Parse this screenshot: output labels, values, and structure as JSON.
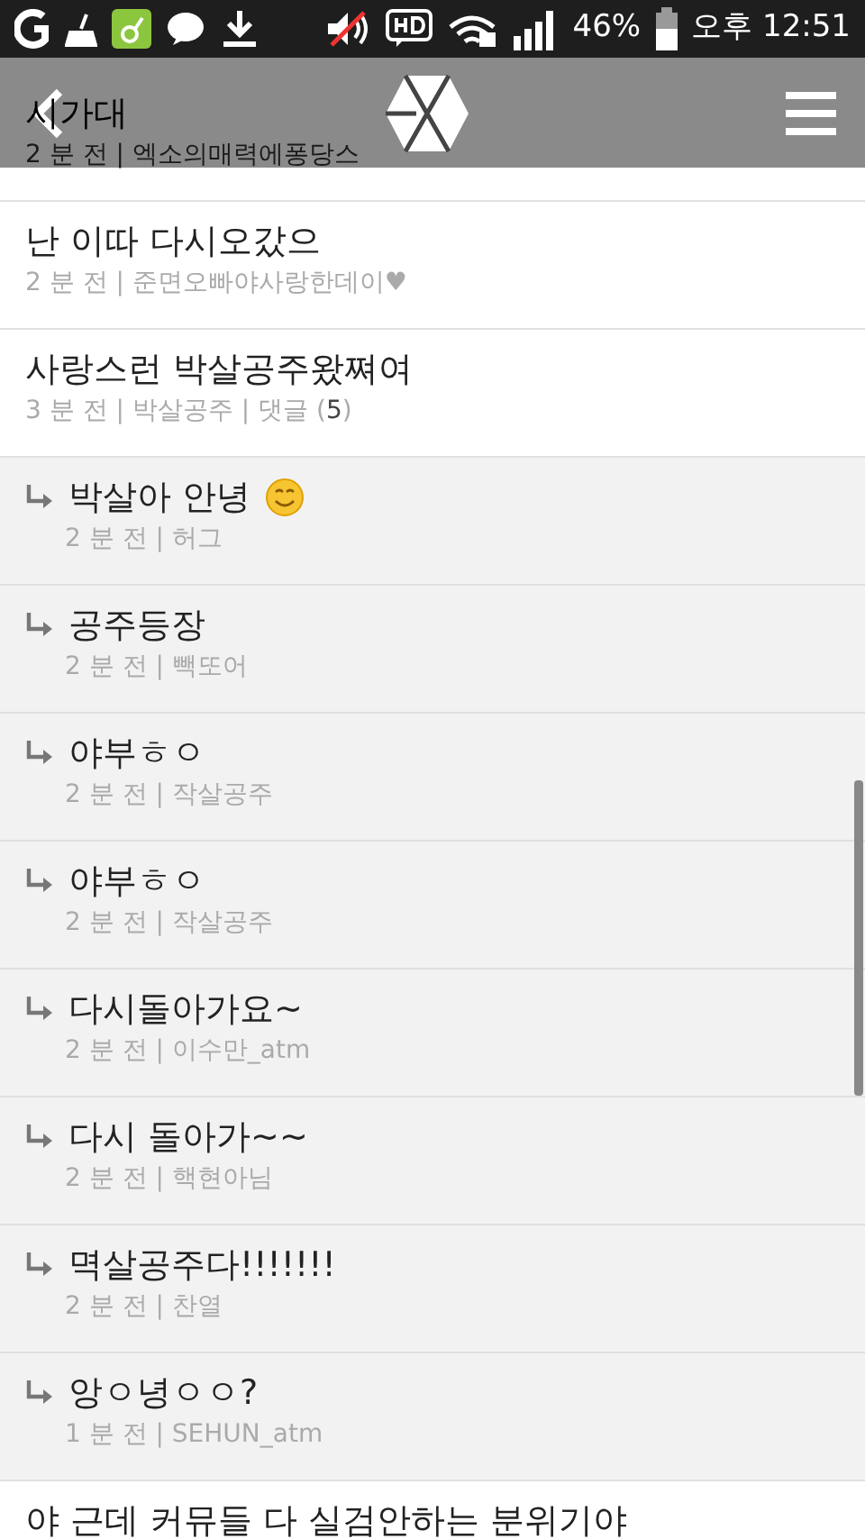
{
  "status_bar": {
    "battery": "46%",
    "time": "오후 12:51"
  },
  "posts": [
    {
      "kind": "post",
      "title": "시가대",
      "meta": "2 분 전 | 엑소의매력에퐁당스"
    },
    {
      "kind": "post",
      "title": "난 이따 다시오갔으",
      "meta": "2 분 전 | 준면오빠야사랑한데이♥"
    },
    {
      "kind": "post",
      "title": "사랑스런 박살공주왔쪄여",
      "meta": "3 분 전 | 박살공주 | 댓글 (**5**)"
    },
    {
      "kind": "reply",
      "title": "박살아 안녕",
      "emoji": true,
      "meta": "2 분 전 | 허그"
    },
    {
      "kind": "reply",
      "title": "공주등장",
      "meta": "2 분 전 | 빽또어"
    },
    {
      "kind": "reply",
      "title": "야부ㅎㅇ",
      "meta": "2 분 전 | 작살공주"
    },
    {
      "kind": "reply",
      "title": "야부ㅎㅇ",
      "meta": "2 분 전 | 작살공주"
    },
    {
      "kind": "reply",
      "title": "다시돌아가요~",
      "meta": "2 분 전 | 이수만_atm"
    },
    {
      "kind": "reply",
      "title": "다시 돌아가~~",
      "meta": "2 분 전 | 핵현아님"
    },
    {
      "kind": "reply",
      "title": "멱살공주다!!!!!!!",
      "meta": "2 분 전 | 찬열"
    },
    {
      "kind": "reply",
      "title": "앙ㅇ녕ㅇㅇ?",
      "meta": "1 분 전 | SEHUN_atm"
    },
    {
      "kind": "post",
      "title": "야 근데 커뮤들 다 실검안하는 분위기야"
    }
  ]
}
